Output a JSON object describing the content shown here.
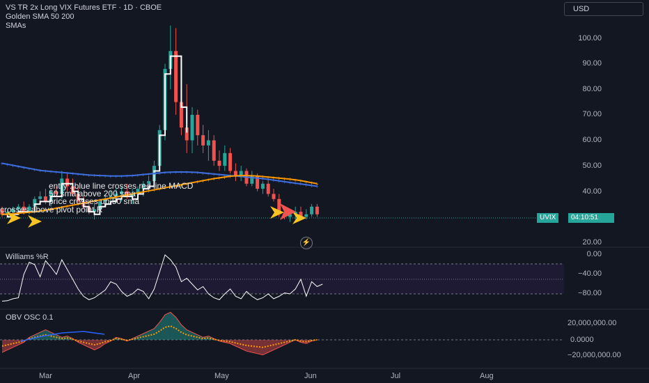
{
  "header": {
    "title": "VS TR 2x Long VIX Futures ETF · 1D · CBOE",
    "indicator1": "Golden SMA 50 200",
    "indicator2": "SMAs"
  },
  "currency": "USD",
  "price_axis": [
    "100.00",
    "90.00",
    "80.00",
    "70.00",
    "60.00",
    "50.00",
    "40.00",
    "20.00"
  ],
  "williams": {
    "title": "Williams %R",
    "ticks": [
      "0.00",
      "−40.00",
      "−80.00"
    ]
  },
  "obv": {
    "title": "OBV OSC 0.1",
    "ticks": [
      "20,000,000.00",
      "0.0000",
      "−20,000,000.00"
    ]
  },
  "time_axis": [
    "Mar",
    "Apr",
    "May",
    "Jun",
    "Jul",
    "Aug"
  ],
  "last_price": {
    "symbol": "UVIX",
    "countdown": "04:10:51"
  },
  "annotations": [
    "entry : blue line crosses red line MACD",
    "50 sma above 200 sma",
    "price crosses up 50 sma",
    "crosses above pivot point R"
  ],
  "colors": {
    "background": "#131722",
    "up": "#26a69a",
    "down": "#ef5350",
    "sma_blue": "#3f6fe0",
    "sma_orange": "#ff9800",
    "williams_band": "#1e1a33"
  },
  "chart_data": {
    "type": "candlestick",
    "ylim": [
      17,
      109
    ],
    "candles": [
      [
        33,
        34,
        30,
        31
      ],
      [
        31,
        33,
        30,
        32
      ],
      [
        32,
        34,
        31,
        33
      ],
      [
        33,
        35,
        32,
        34
      ],
      [
        34,
        36,
        31,
        32
      ],
      [
        32,
        35,
        31,
        34
      ],
      [
        34,
        38,
        33,
        37
      ],
      [
        37,
        40,
        35,
        38
      ],
      [
        38,
        41,
        35,
        36
      ],
      [
        36,
        41,
        34,
        40
      ],
      [
        40,
        42,
        38,
        39
      ],
      [
        39,
        48,
        37,
        45
      ],
      [
        45,
        47,
        40,
        42
      ],
      [
        42,
        45,
        38,
        39
      ],
      [
        39,
        42,
        35,
        36
      ],
      [
        36,
        38,
        33,
        34
      ],
      [
        34,
        36,
        31,
        32
      ],
      [
        32,
        35,
        29,
        33
      ],
      [
        33,
        37,
        32,
        36
      ],
      [
        36,
        39,
        34,
        37
      ],
      [
        37,
        40,
        35,
        38
      ],
      [
        38,
        41,
        36,
        39
      ],
      [
        39,
        42,
        36,
        40
      ],
      [
        40,
        43,
        37,
        38
      ],
      [
        38,
        41,
        35,
        39
      ],
      [
        39,
        42,
        37,
        41
      ],
      [
        41,
        44,
        38,
        43
      ],
      [
        43,
        46,
        40,
        44
      ],
      [
        44,
        52,
        43,
        50
      ],
      [
        50,
        66,
        48,
        64
      ],
      [
        64,
        90,
        60,
        88
      ],
      [
        88,
        105,
        80,
        95
      ],
      [
        95,
        104,
        70,
        75
      ],
      [
        75,
        88,
        62,
        65
      ],
      [
        65,
        82,
        55,
        60
      ],
      [
        60,
        73,
        55,
        70
      ],
      [
        70,
        72,
        58,
        62
      ],
      [
        62,
        66,
        55,
        58
      ],
      [
        58,
        64,
        52,
        60
      ],
      [
        60,
        62,
        50,
        52
      ],
      [
        52,
        56,
        48,
        50
      ],
      [
        50,
        58,
        48,
        55
      ],
      [
        55,
        57,
        47,
        48
      ],
      [
        48,
        51,
        44,
        46
      ],
      [
        46,
        50,
        44,
        48
      ],
      [
        48,
        49,
        42,
        43
      ],
      [
        43,
        48,
        42,
        46
      ],
      [
        46,
        47,
        40,
        41
      ],
      [
        41,
        44,
        39,
        43
      ],
      [
        43,
        45,
        38,
        39
      ],
      [
        39,
        41,
        36,
        37
      ],
      [
        37,
        39,
        30,
        31
      ],
      [
        31,
        33,
        29,
        30
      ],
      [
        30,
        32,
        28,
        31
      ],
      [
        31,
        34,
        29,
        32
      ],
      [
        32,
        34,
        29,
        30
      ],
      [
        30,
        33,
        29,
        31
      ],
      [
        31,
        35,
        30,
        34
      ],
      [
        34,
        35,
        30,
        31
      ]
    ],
    "sma_blue": [
      51,
      50.6,
      50.2,
      49.8,
      49.4,
      49,
      48.6,
      48.2,
      48,
      47.8,
      47.6,
      47.4,
      47.2,
      47,
      46.8,
      46.6,
      46.4,
      46.3,
      46.2,
      46.1,
      46,
      46,
      46,
      46.1,
      46.2,
      46.4,
      46.6,
      46.8,
      47,
      47.2,
      47.4,
      47.5,
      47.6,
      47.6,
      47.6,
      47.5,
      47.4,
      47.2,
      47,
      46.8,
      46.6,
      46.4,
      46.2,
      46,
      45.8,
      45.6,
      45.4,
      45.2,
      45,
      44.7,
      44.4,
      44.1,
      43.8,
      43.5,
      43.2,
      42.9,
      42.6,
      42.3,
      42
    ],
    "sma_orange": [
      31,
      31.1,
      31.2,
      31.4,
      31.6,
      31.8,
      32,
      32.3,
      32.6,
      33,
      33.4,
      33.8,
      34.2,
      34.6,
      35,
      35.4,
      35.8,
      36.2,
      36.6,
      37,
      37.4,
      37.8,
      38.2,
      38.6,
      39,
      39.4,
      39.8,
      40.2,
      40.6,
      41,
      41.4,
      41.8,
      42.2,
      42.6,
      43,
      43.4,
      43.8,
      44.2,
      44.6,
      45,
      45.3,
      45.6,
      45.9,
      46.1,
      46.2,
      46.2,
      46.1,
      46,
      45.8,
      45.6,
      45.4,
      45.2,
      45,
      44.8,
      44.5,
      44.2,
      43.8,
      43.4,
      43
    ]
  }
}
